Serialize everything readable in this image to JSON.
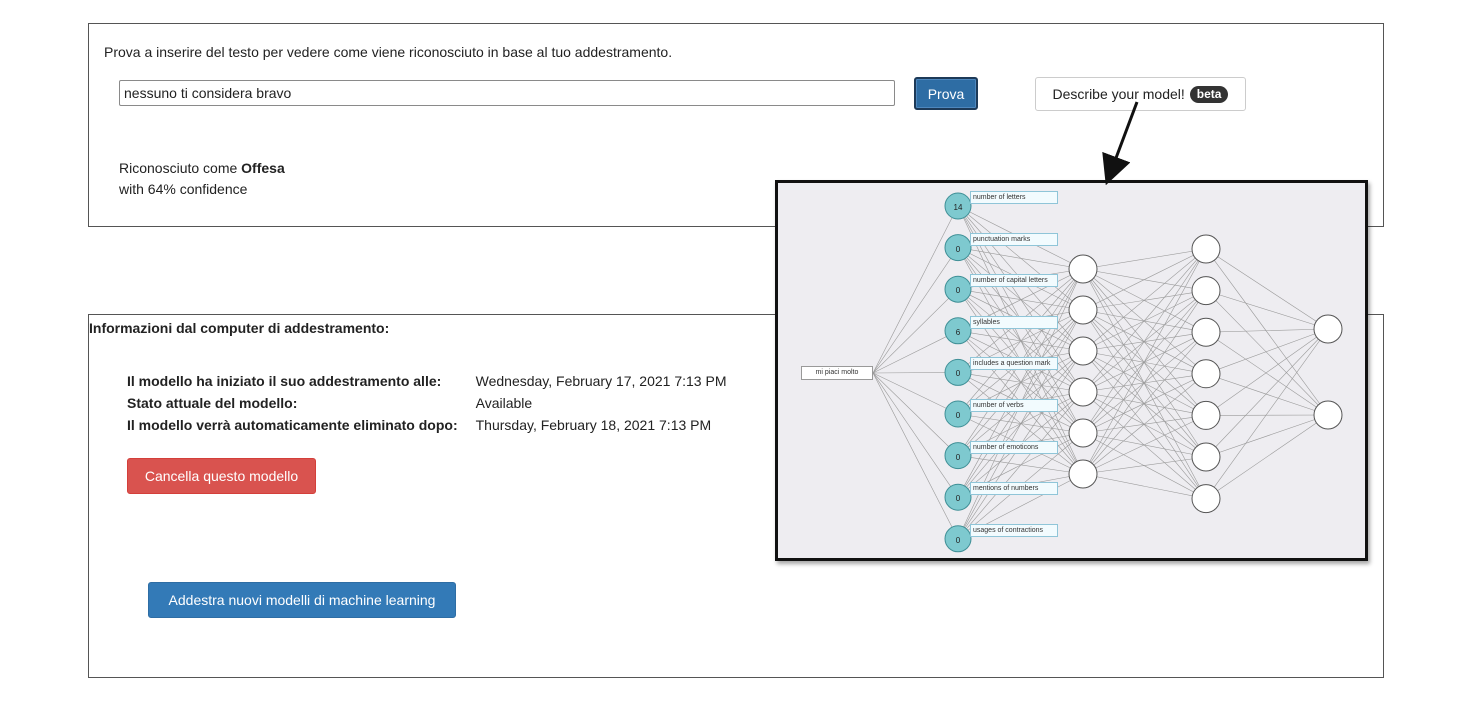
{
  "test": {
    "prompt": "Prova a inserire del testo per vedere come viene riconosciuto in base al tuo addestramento.",
    "input_value": "nessuno ti considera bravo",
    "prova_label": "Prova",
    "describe_label": "Describe your model!",
    "beta_label": "beta",
    "result_prefix": "Riconosciuto come ",
    "result_label": "Offesa",
    "confidence": "with 64% confidence"
  },
  "info": {
    "title": "Informazioni dal computer di addestramento:",
    "rows": [
      {
        "key": "Il modello ha iniziato il suo addestramento alle:",
        "value": "Wednesday, February 17, 2021 7:13 PM"
      },
      {
        "key": "Stato attuale del modello:",
        "value": "Available"
      },
      {
        "key": "Il modello verrà automaticamente eliminato dopo:",
        "value": "Thursday, February 18, 2021 7:13 PM"
      }
    ],
    "delete_label": "Cancella questo modello",
    "train_label": "Addestra nuovi modelli di machine learning"
  },
  "network": {
    "input_text": "mi piaci molto",
    "features": [
      {
        "label": "number of letters",
        "value": "14"
      },
      {
        "label": "punctuation marks",
        "value": "0"
      },
      {
        "label": "number of capital letters",
        "value": "0"
      },
      {
        "label": "syllables",
        "value": "6"
      },
      {
        "label": "includes a question mark",
        "value": "0"
      },
      {
        "label": "number of verbs",
        "value": "0"
      },
      {
        "label": "number of emoticons",
        "value": "0"
      },
      {
        "label": "mentions of numbers",
        "value": "0"
      },
      {
        "label": "usages of contractions",
        "value": "0"
      }
    ],
    "hidden1_count": 6,
    "hidden2_count": 7,
    "output_count": 2,
    "feature_node_color": "#7ec9cf",
    "edge_color": "#9a9a9a"
  }
}
